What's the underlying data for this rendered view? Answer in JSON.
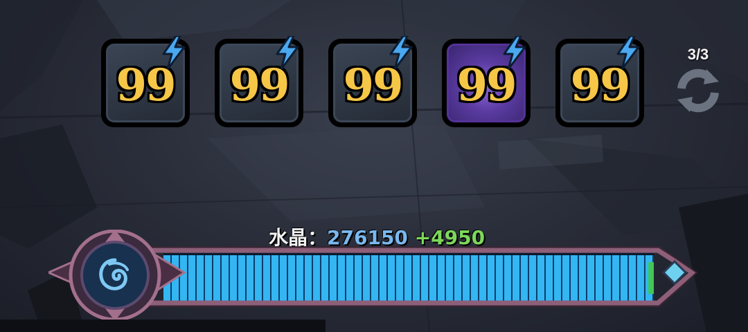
{
  "cards": [
    {
      "value": "99",
      "selected": false
    },
    {
      "value": "99",
      "selected": false
    },
    {
      "value": "99",
      "selected": false
    },
    {
      "value": "99",
      "selected": true
    },
    {
      "value": "99",
      "selected": false
    }
  ],
  "refresh": {
    "count": "3/3",
    "icon": "refresh-icon"
  },
  "crystal": {
    "label": "水晶：",
    "value": "276150",
    "delta": "+4950",
    "fill_fraction": 1.0
  },
  "colors": {
    "number": "#f6c647",
    "bolt": "#4aa8f0",
    "selected": "#6b45b8",
    "crystal_value": "#7ab8ee",
    "crystal_delta": "#7dd85a",
    "bar_fill": "#33b6f2"
  }
}
